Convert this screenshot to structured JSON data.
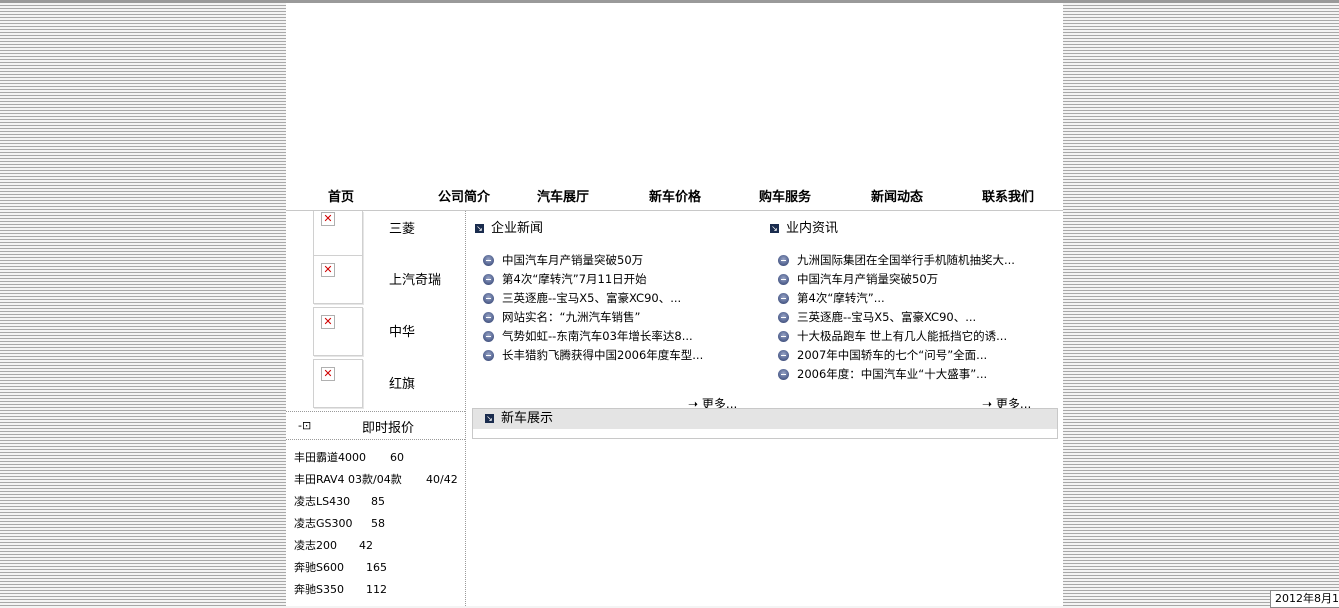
{
  "nav": [
    "首页",
    "公司简介",
    "汽车展厅",
    "新车价格",
    "购车服务",
    "新闻动态",
    "联系我们"
  ],
  "brands": [
    "三菱",
    "上汽奇瑞",
    "中华",
    "红旗"
  ],
  "quote": {
    "icon": "login-arrow-icon",
    "title": "即时报价",
    "items": [
      {
        "name": "丰田霸道4000",
        "price": "60"
      },
      {
        "name": "丰田RAV4 03款/04款",
        "price": "40/42"
      },
      {
        "name": "凌志LS430",
        "price": "85"
      },
      {
        "name": "凌志GS300",
        "price": "58"
      },
      {
        "name": "凌志200",
        "price": "42"
      },
      {
        "name": "奔驰S600",
        "price": "165"
      },
      {
        "name": "奔驰S350",
        "price": "112"
      }
    ]
  },
  "news_company": {
    "title": "企业新闻",
    "items": [
      "中国汽车月产销量突破50万",
      "第4次“摩转汽”7月11日开始",
      "三英逐鹿--宝马X5、富豪XC90、...",
      "网站实名：“九洲汽车销售”",
      "气势如虹--东南汽车03年增长率达8...",
      "长丰猎豹飞腾获得中国2006年度车型..."
    ],
    "more": "更多..."
  },
  "news_industry": {
    "title": "业内资讯",
    "items": [
      "九洲国际集团在全国举行手机随机抽奖大...",
      "中国汽车月产销量突破50万",
      "第4次“摩转汽”...",
      "三英逐鹿--宝马X5、富豪XC90、...",
      "十大极品跑车 世上有几人能抵挡它的诱...",
      "2007年中国轿车的七个“问号”全面...",
      "2006年度：中国汽车业“十大盛事”..."
    ],
    "more": "更多..."
  },
  "new_cars": {
    "title": "新车展示"
  },
  "tooltip": "2012年8月1"
}
